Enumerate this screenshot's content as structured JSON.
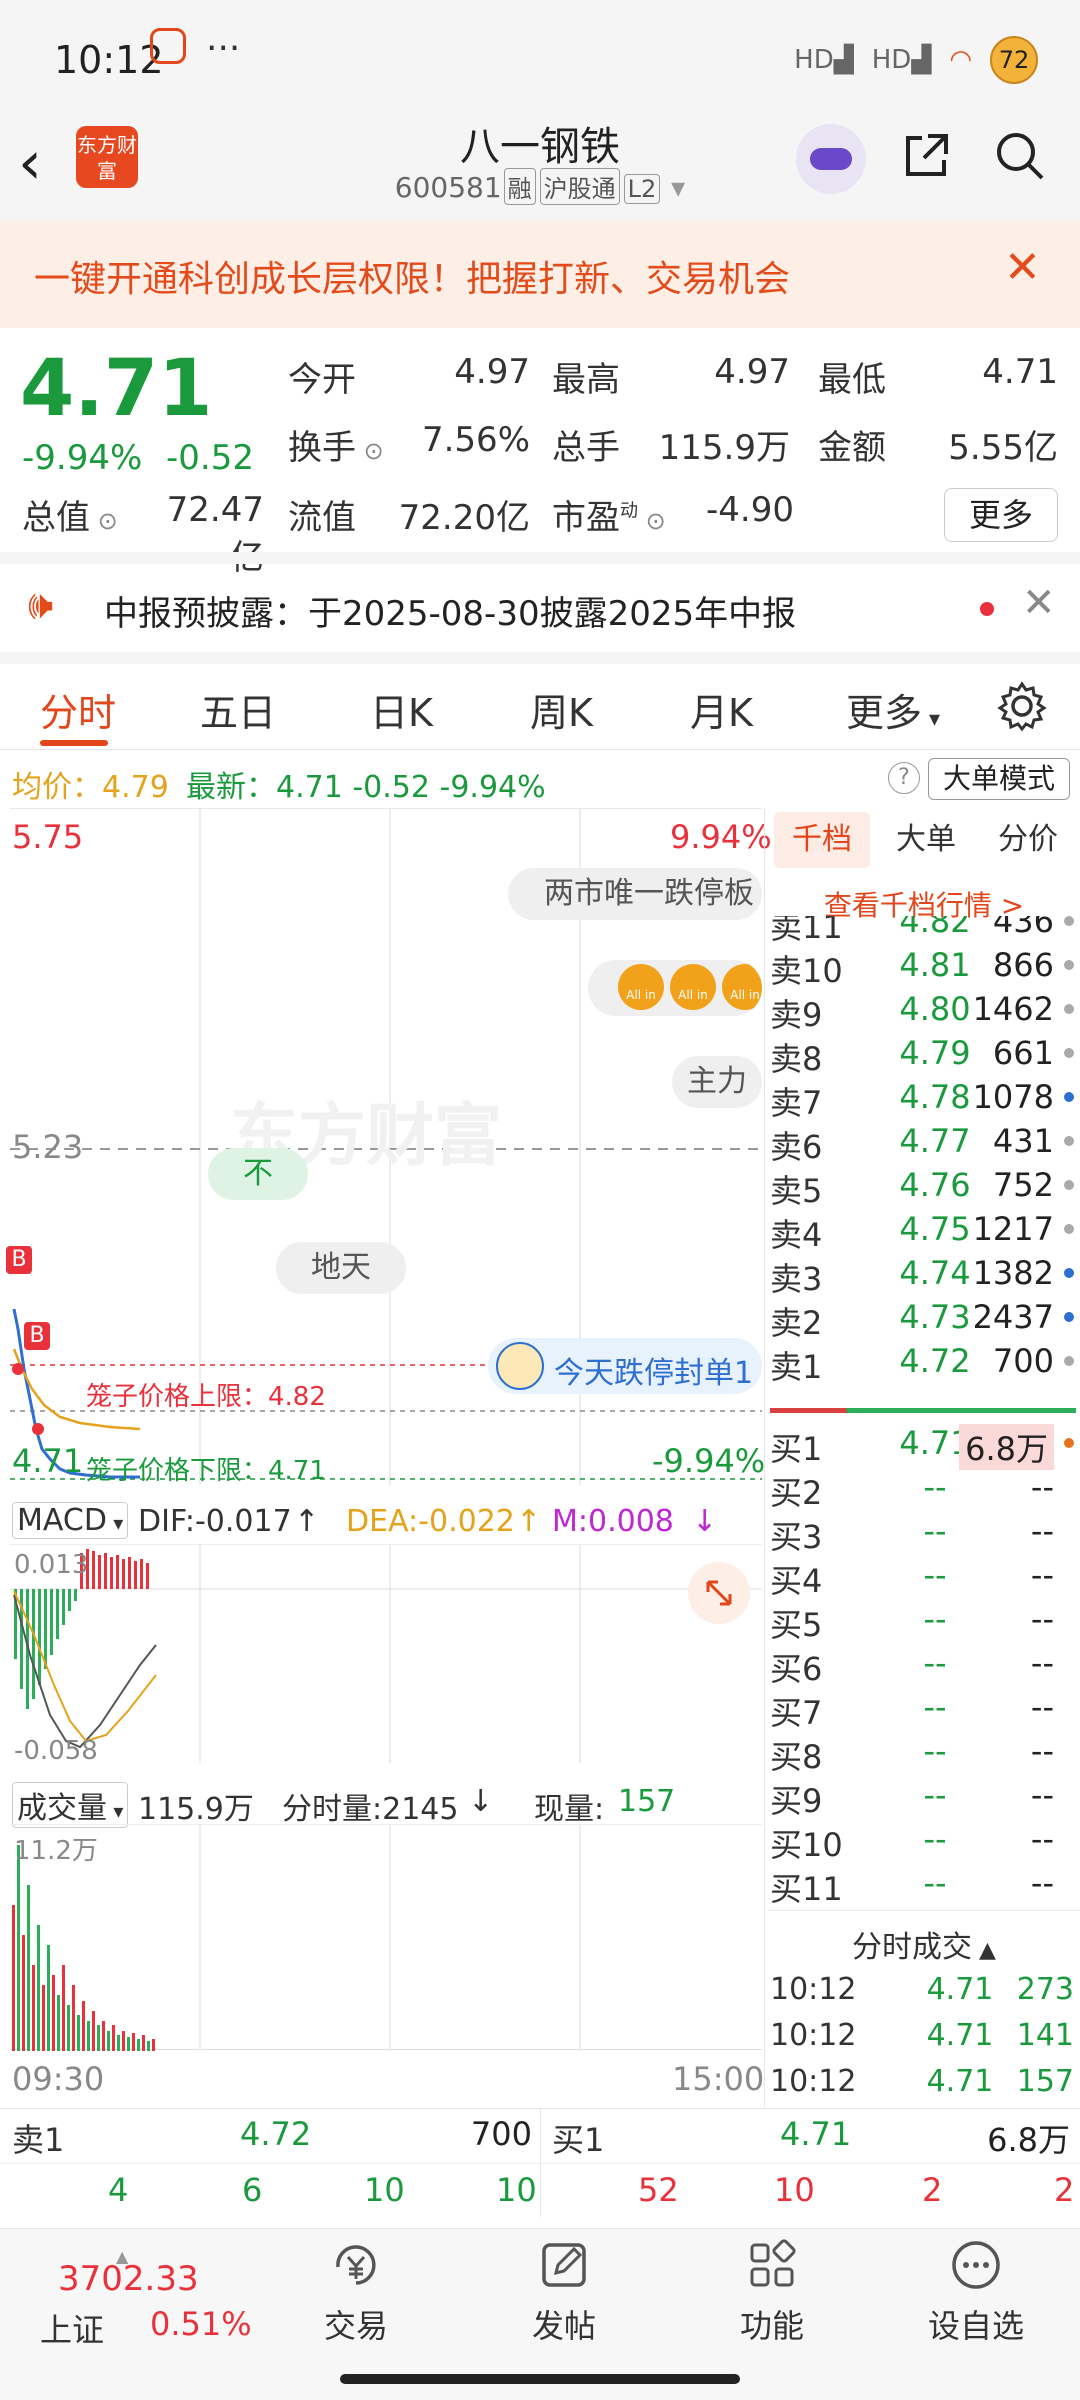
{
  "status_bar": {
    "time": "10:12",
    "dots": "···",
    "net1": "HD",
    "net2": "HD",
    "battery": "72"
  },
  "header": {
    "back": "‹",
    "logo": "东方财富",
    "name": "八一钢铁",
    "code": "600581",
    "tags": [
      "融",
      "沪股通",
      "L2"
    ],
    "share_icon": "share-icon",
    "search_icon": "search-icon"
  },
  "banner": {
    "text": "一键开通科创成长层权限！把握打新、交易机会",
    "close": "✕"
  },
  "quote": {
    "price": "4.71",
    "pct": "-9.94%",
    "chg": "-0.52",
    "open_label": "今开",
    "open": "4.97",
    "high_label": "最高",
    "high": "4.97",
    "low_label": "最低",
    "low": "4.71",
    "turnover_label": "换手",
    "turnover": "7.56%",
    "volume_label": "总手",
    "volume": "115.9万",
    "amount_label": "金额",
    "amount": "5.55亿",
    "mktcap_label": "总值",
    "mktcap": "72.47亿",
    "float_label": "流值",
    "float": "72.20亿",
    "pe_label": "市盈",
    "pe_sup": "动",
    "pe": "-4.90",
    "more": "更多"
  },
  "notice": {
    "text": "中报预披露：于2025-08-30披露2025年中报",
    "close": "✕"
  },
  "tabs": [
    "分时",
    "五日",
    "日K",
    "周K",
    "月K",
    "更多"
  ],
  "info_line": {
    "avg_label": "均价：",
    "avg": "4.79",
    "latest_label": "最新：",
    "latest": "4.71",
    "latest_chg": "-0.52",
    "latest_pct": "-9.94%",
    "help": "?",
    "mode": "大单模式"
  },
  "chart": {
    "y_top": "5.75",
    "y_mid": "5.23",
    "y_bottom": "4.71",
    "pct_top": "9.94%",
    "pct_bottom": "-9.94%",
    "pill1": "两市唯一跌停板",
    "pill2": "主力",
    "pill3": "不",
    "pill4": "地天",
    "pill5": "今天跌停封单1",
    "coin": "All in",
    "watermark": "东方财富",
    "cage_upper": "笼子价格上限：4.82",
    "cage_lower": "笼子价格下限：4.71",
    "marker": "B",
    "time_start": "09:30",
    "time_end": "15:00"
  },
  "macd": {
    "name": "MACD",
    "dif": "DIF:-0.017",
    "dea": "DEA:-0.022",
    "m": "M:0.008",
    "top": "0.013",
    "bottom": "-0.058"
  },
  "volume": {
    "name": "成交量",
    "total": "115.9万",
    "fsl": "分时量:2145",
    "now_label": "现量:",
    "now": "157",
    "top": "11.2万"
  },
  "orderbook": {
    "tabs": [
      "千档",
      "大单",
      "分价"
    ],
    "link": "查看千档行情 >",
    "sell": [
      {
        "label": "卖11",
        "price": "4.82",
        "vol": "436",
        "dot": "g"
      },
      {
        "label": "卖10",
        "price": "4.81",
        "vol": "866",
        "dot": "g"
      },
      {
        "label": "卖9",
        "price": "4.80",
        "vol": "1462",
        "dot": "g"
      },
      {
        "label": "卖8",
        "price": "4.79",
        "vol": "661",
        "dot": "g"
      },
      {
        "label": "卖7",
        "price": "4.78",
        "vol": "1078",
        "dot": "b"
      },
      {
        "label": "卖6",
        "price": "4.77",
        "vol": "431",
        "dot": "g"
      },
      {
        "label": "卖5",
        "price": "4.76",
        "vol": "752",
        "dot": "g"
      },
      {
        "label": "卖4",
        "price": "4.75",
        "vol": "1217",
        "dot": "g"
      },
      {
        "label": "卖3",
        "price": "4.74",
        "vol": "1382",
        "dot": "b"
      },
      {
        "label": "卖2",
        "price": "4.73",
        "vol": "2437",
        "dot": "b"
      },
      {
        "label": "卖1",
        "price": "4.72",
        "vol": "700",
        "dot": "g"
      }
    ],
    "buy": [
      {
        "label": "买1",
        "price": "4.71",
        "vol": "6.8万",
        "dot": "o"
      },
      {
        "label": "买2",
        "price": "--",
        "vol": "--"
      },
      {
        "label": "买3",
        "price": "--",
        "vol": "--"
      },
      {
        "label": "买4",
        "price": "--",
        "vol": "--"
      },
      {
        "label": "买5",
        "price": "--",
        "vol": "--"
      },
      {
        "label": "买6",
        "price": "--",
        "vol": "--"
      },
      {
        "label": "买7",
        "price": "--",
        "vol": "--"
      },
      {
        "label": "买8",
        "price": "--",
        "vol": "--"
      },
      {
        "label": "买9",
        "price": "--",
        "vol": "--"
      },
      {
        "label": "买10",
        "price": "--",
        "vol": "--"
      },
      {
        "label": "买11",
        "price": "--",
        "vol": "--"
      }
    ],
    "ticks_title": "分时成交",
    "ticks": [
      {
        "time": "10:12",
        "price": "4.71",
        "vol": "273"
      },
      {
        "time": "10:12",
        "price": "4.71",
        "vol": "141"
      },
      {
        "time": "10:12",
        "price": "4.71",
        "vol": "157"
      }
    ]
  },
  "bottom_quote": {
    "sell_label": "卖1",
    "sell_price": "4.72",
    "sell_vol": "700",
    "buy_label": "买1",
    "buy_price": "4.71",
    "buy_vol": "6.8万",
    "sell_counts": [
      "4",
      "6",
      "10",
      "10"
    ],
    "buy_counts": [
      "52",
      "10",
      "2",
      "2"
    ]
  },
  "nav": {
    "index_value": "3702.33",
    "index_name": "上证",
    "index_pct": "0.51%",
    "items": [
      "交易",
      "发帖",
      "功能",
      "设自选"
    ]
  },
  "colors": {
    "up": "#e8313a",
    "down": "#1a9a3c",
    "accent": "#e3461a",
    "avg": "#e5a21b",
    "macd_dea": "#e5a21b",
    "macd_m": "#c026d3"
  }
}
